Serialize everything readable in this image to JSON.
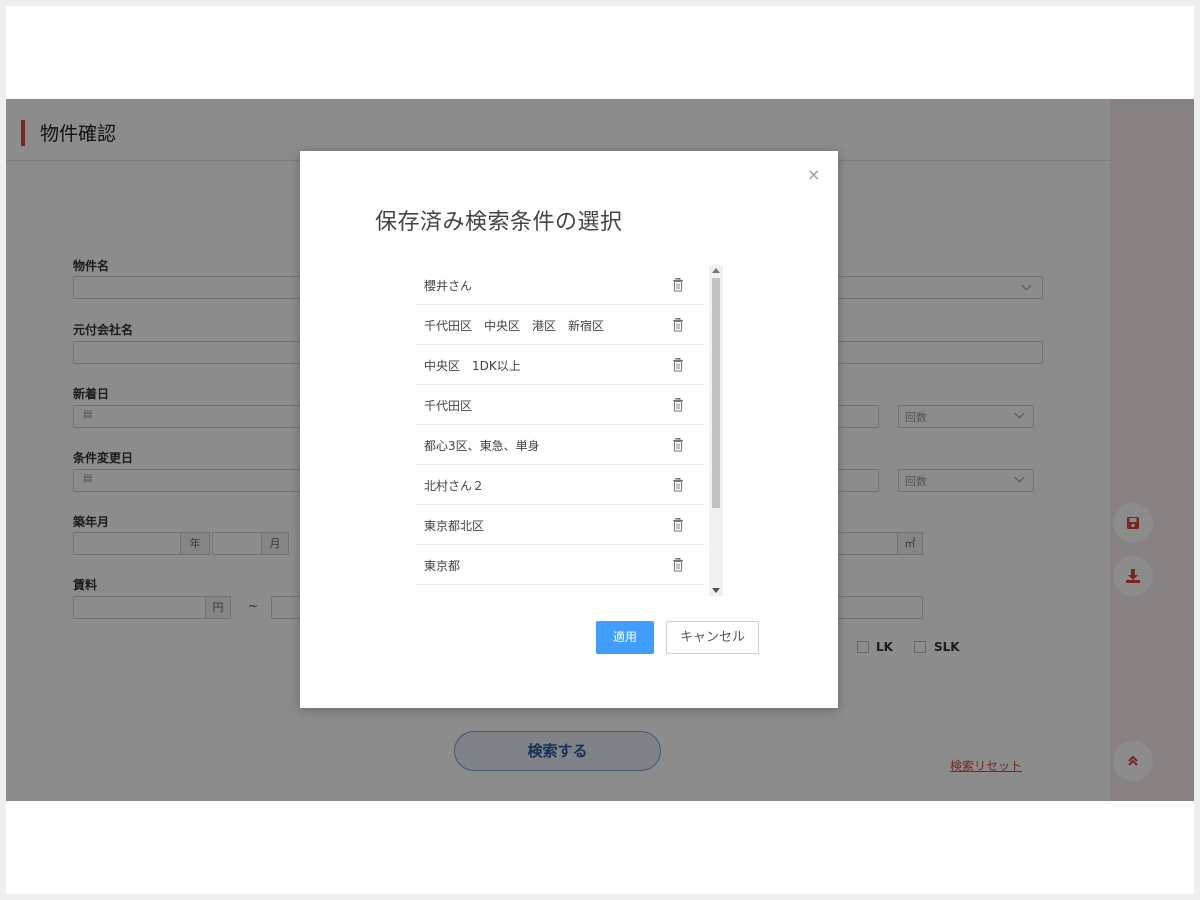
{
  "page": {
    "title": "物件確認"
  },
  "form": {
    "labels": {
      "property_name": "物件名",
      "original_company": "元付会社名",
      "new_arrival_date": "新着日",
      "condition_change_date": "条件変更日",
      "built_year_month": "築年月",
      "rent": "賃料"
    },
    "suffix_year": "年",
    "suffix_month": "月",
    "suffix_yen": "円",
    "suffix_sqm": "㎡",
    "tilde": "~",
    "select_placeholder": "回数",
    "checkbox_lk": "LK",
    "checkbox_slk": "SLK"
  },
  "actions": {
    "search_label": "検索する",
    "reset_label": "検索リセット"
  },
  "modal": {
    "title": "保存済み検索条件の選択",
    "close_symbol": "×",
    "items": [
      {
        "label": "櫻井さん"
      },
      {
        "label": "千代田区　中央区　港区　新宿区"
      },
      {
        "label": "中央区　1DK以上"
      },
      {
        "label": "千代田区"
      },
      {
        "label": "都心3区、東急、単身"
      },
      {
        "label": "北村さん２"
      },
      {
        "label": "東京都北区"
      },
      {
        "label": "東京都"
      }
    ],
    "apply_label": "適用",
    "cancel_label": "キャンセル"
  },
  "colors": {
    "accent_red": "#d9453c",
    "primary_blue": "#409eff"
  },
  "icons": {
    "trash": "trash-icon",
    "save": "save-icon",
    "download": "download-icon",
    "scroll_top": "double-chevron-up-icon",
    "calendar": "calendar-icon"
  }
}
